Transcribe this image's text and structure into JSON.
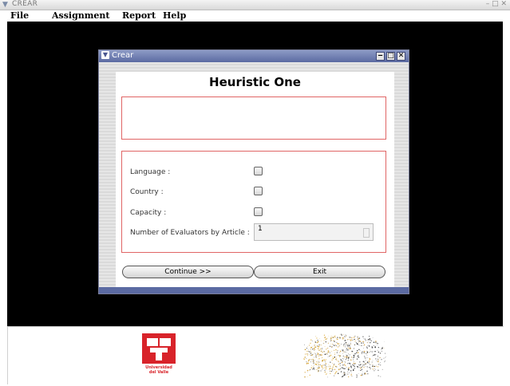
{
  "outer_window": {
    "title": "CREAR",
    "buttons": "– □ ✕"
  },
  "menubar": {
    "items": [
      {
        "label": "File",
        "mnemonic": "F"
      },
      {
        "label": "Assignment",
        "mnemonic": "A"
      },
      {
        "label": "Report",
        "mnemonic": "R"
      },
      {
        "label": "Help",
        "mnemonic": "H"
      }
    ]
  },
  "dialog": {
    "title": "Crear",
    "heading": "Heuristic One",
    "fields": {
      "language_label": "Language :",
      "country_label": "Country :",
      "capacity_label": "Capacity :",
      "evaluators_label": "Number of Evaluators by Article :",
      "evaluators_value": "1"
    },
    "buttons": {
      "continue": "Continue >>",
      "exit": "Exit"
    },
    "window_buttons": {
      "minimize": "‒",
      "maximize": "□",
      "close": "✕"
    }
  },
  "footer": {
    "logo_caption_line1": "Universidad",
    "logo_caption_line2": "del Valle"
  },
  "colors": {
    "desktop_bg": "#000000",
    "dialog_title_bg": "#5b6aa2",
    "red_border": "#e06565",
    "logo_red": "#d8232a"
  },
  "icons": {
    "outer_menu": "chevron-down-icon",
    "dialog_menu": "chevron-down-icon"
  }
}
